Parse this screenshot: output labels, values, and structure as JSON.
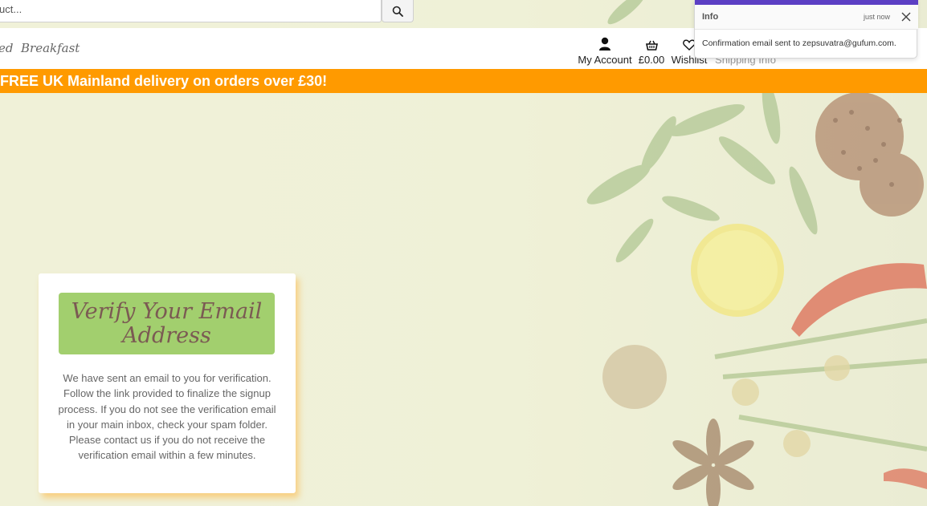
{
  "search": {
    "placeholder": "uct...",
    "button_icon": "search-icon"
  },
  "nav": {
    "links": [
      {
        "label": "ed"
      },
      {
        "label": "Breakfast"
      }
    ],
    "tools": {
      "account": {
        "label": "My Account",
        "icon": "user-icon"
      },
      "basket": {
        "label": "£0.00",
        "icon": "basket-icon"
      },
      "wishlist": {
        "label": "Wishlist",
        "icon": "heart-icon"
      },
      "shipping": {
        "label": "Shipping Info",
        "icon": "document-icon"
      }
    }
  },
  "banner": {
    "strong": "FREE UK Mainland delivery",
    "rest": " on orders over £30!"
  },
  "card": {
    "title": "Verify Your Email Address",
    "body": "We have sent an email to you for verification. Follow the link provided to finalize the signup process. If you do not see the verification email in your main inbox, check your spam folder. Please contact us if you do not receive the verification email within a few minutes."
  },
  "toast": {
    "title": "Info",
    "time": "just now",
    "message": "Confirmation email sent to zepsuvatra@gufum.com."
  },
  "colors": {
    "banner": "#ff9a00",
    "card_title_bg": "#a2cf6e",
    "card_title_text": "#7b5a53",
    "toast_accent": "#5c3fc4"
  }
}
